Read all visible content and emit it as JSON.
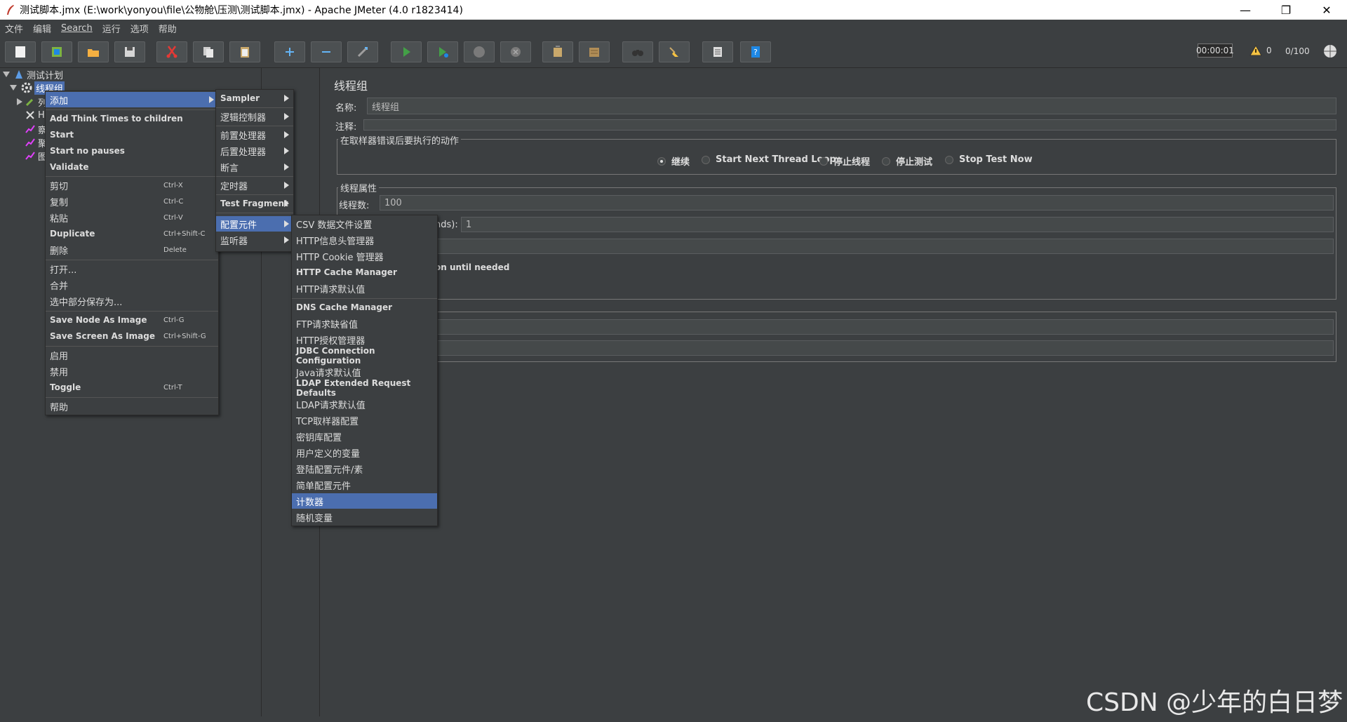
{
  "window": {
    "title": "测试脚本.jmx (E:\\work\\yonyou\\file\\公物舱\\压测\\测试脚本.jmx) - Apache JMeter (4.0 r1823414)",
    "minimize": "—",
    "restore": "❐",
    "close": "✕"
  },
  "menubar": [
    "文件",
    "编辑",
    "Search",
    "运行",
    "选项",
    "帮助"
  ],
  "toolbar": {
    "timer": "00:00:01",
    "warnings": "0",
    "threads": "0/100"
  },
  "tree": {
    "test_plan": "测试计划",
    "thread_group": "线程组",
    "children_partial": [
      "列",
      "H",
      "察",
      "聚",
      "图"
    ]
  },
  "panel": {
    "title": "线程组",
    "name_label": "名称:",
    "name_value": "线程组",
    "comment_label": "注释:",
    "comment_value": "",
    "error_action_title": "在取样器错误后要执行的动作",
    "error_actions": [
      "继续",
      "Start Next Thread Loop",
      "停止线程",
      "停止测试",
      "Stop Test Now"
    ],
    "selected_action": "继续",
    "thread_props_title": "线程属性",
    "threads_label": "线程数:",
    "threads_value": "100",
    "rampup_label_partial": "nds):",
    "rampup_value": "1",
    "delay_partial": "on until needed"
  },
  "context_menu": {
    "items": [
      {
        "label": "添加",
        "submenu": true,
        "selected": true
      },
      {
        "label": "Add Think Times to children"
      },
      {
        "label": "Start"
      },
      {
        "label": "Start no pauses"
      },
      {
        "label": "Validate"
      },
      {
        "label": "剪切",
        "shortcut": "Ctrl-X"
      },
      {
        "label": "复制",
        "shortcut": "Ctrl-C"
      },
      {
        "label": "粘贴",
        "shortcut": "Ctrl-V"
      },
      {
        "label": "Duplicate",
        "shortcut": "Ctrl+Shift-C"
      },
      {
        "label": "删除",
        "shortcut": "Delete"
      },
      {
        "label": "打开..."
      },
      {
        "label": "合并"
      },
      {
        "label": "选中部分保存为..."
      },
      {
        "label": "Save Node As Image",
        "shortcut": "Ctrl-G"
      },
      {
        "label": "Save Screen As Image",
        "shortcut": "Ctrl+Shift-G"
      },
      {
        "label": "启用"
      },
      {
        "label": "禁用"
      },
      {
        "label": "Toggle",
        "shortcut": "Ctrl-T"
      },
      {
        "label": "帮助"
      }
    ]
  },
  "add_submenu": {
    "items": [
      "Sampler",
      "逻辑控制器",
      "前置处理器",
      "后置处理器",
      "断言",
      "定时器",
      "Test Fragment",
      "配置元件",
      "监听器"
    ],
    "selected": "配置元件"
  },
  "config_submenu": {
    "items": [
      "CSV 数据文件设置",
      "HTTP信息头管理器",
      "HTTP Cookie 管理器",
      "HTTP Cache Manager",
      "HTTP请求默认值",
      "DNS Cache Manager",
      "FTP请求缺省值",
      "HTTP授权管理器",
      "JDBC Connection Configuration",
      "Java请求默认值",
      "LDAP Extended Request Defaults",
      "LDAP请求默认值",
      "TCP取样器配置",
      "密钥库配置",
      "用户定义的变量",
      "登陆配置元件/素",
      "简单配置元件",
      "计数器",
      "随机变量"
    ],
    "selected": "计数器"
  },
  "watermark": "CSDN @少年的白日梦",
  "colors": {
    "background": "#3c3f41",
    "selection": "#4b6eaf"
  }
}
